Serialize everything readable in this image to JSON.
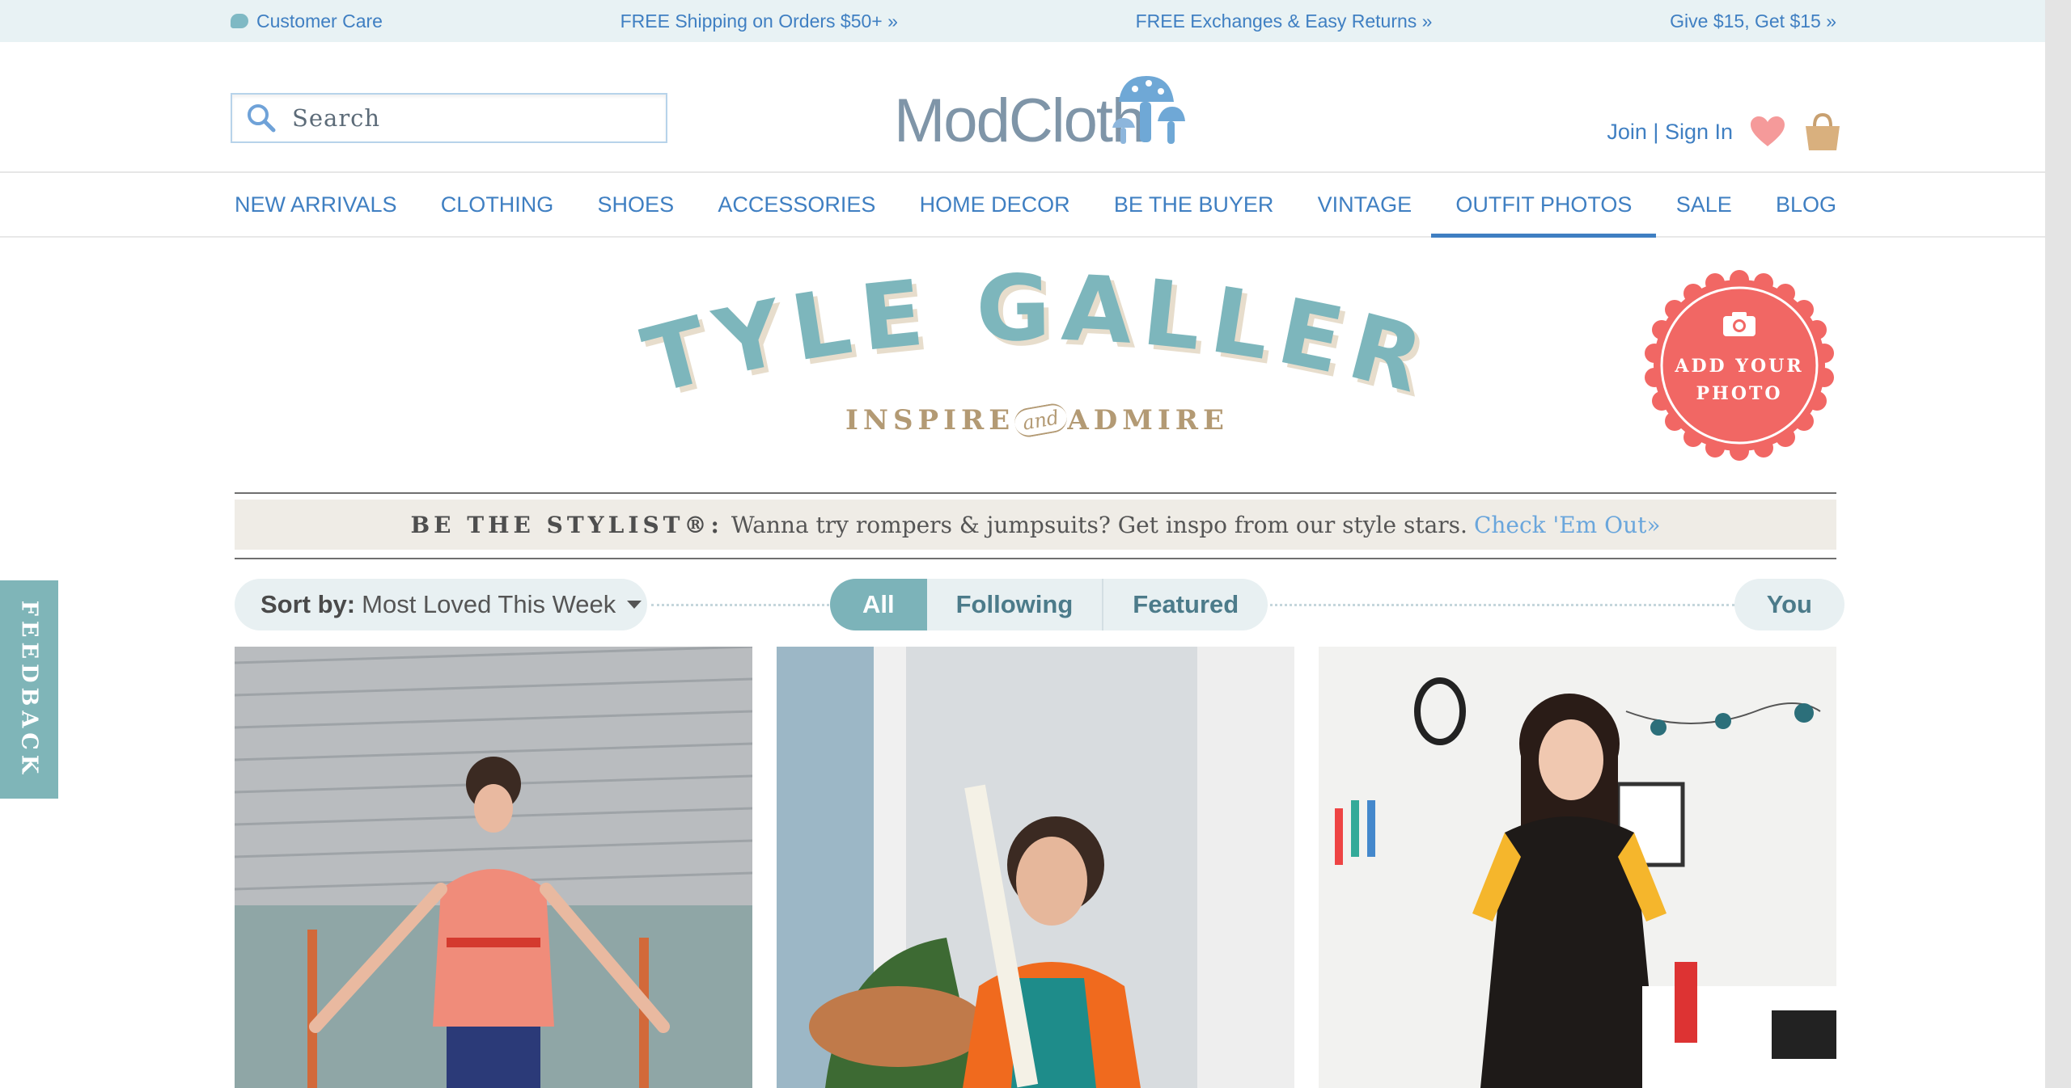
{
  "utility": {
    "customer_care": "Customer Care",
    "shipping": "FREE Shipping on Orders $50+ »",
    "exchanges": "FREE Exchanges & Easy Returns »",
    "referral": "Give $15, Get $15 »"
  },
  "header": {
    "search_placeholder": "Search",
    "logo_text": "ModCloth",
    "join_sign_in": "Join | Sign In"
  },
  "nav": {
    "items": [
      "NEW ARRIVALS",
      "CLOTHING",
      "SHOES",
      "ACCESSORIES",
      "HOME DECOR",
      "BE THE BUYER",
      "VINTAGE",
      "OUTFIT PHOTOS",
      "SALE",
      "BLOG"
    ],
    "active": "OUTFIT PHOTOS"
  },
  "gallery": {
    "title": "STYLE GALLERY",
    "tagline_left": "INSPIRE",
    "tagline_and": "and",
    "tagline_right": "ADMIRE",
    "add_photo_line1": "ADD YOUR",
    "add_photo_line2": "PHOTO"
  },
  "stylist_banner": {
    "label": "BE THE STYLIST®:",
    "text": "Wanna try rompers & jumpsuits? Get inspo from our style stars.",
    "link": "Check 'Em Out»"
  },
  "filters": {
    "sort_label": "Sort by:",
    "sort_value": "Most Loved This Week",
    "tabs": [
      "All",
      "Following",
      "Featured"
    ],
    "active_tab": "All",
    "you": "You"
  },
  "feedback": "FEEDBACK",
  "colors": {
    "accent_blue": "#3f7fc2",
    "teal": "#7cb3b9",
    "coral": "#f16764",
    "tan": "#b39a74",
    "utility_bg": "#e8f2f4"
  }
}
